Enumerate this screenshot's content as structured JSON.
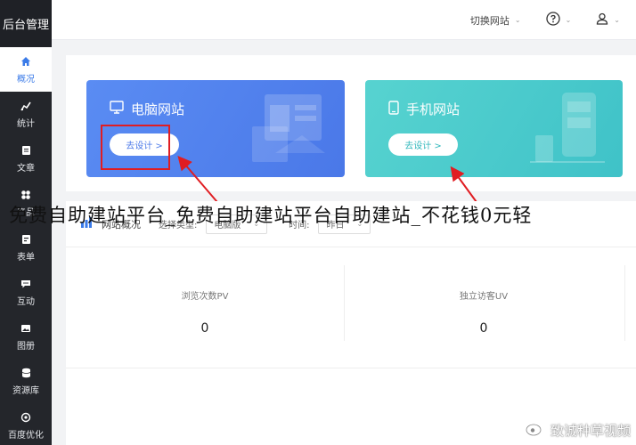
{
  "sidebar": {
    "logo": "后台管理",
    "items": [
      {
        "label": "概况",
        "icon": "home-icon"
      },
      {
        "label": "统计",
        "icon": "stats-icon"
      },
      {
        "label": "文章",
        "icon": "article-icon"
      },
      {
        "label": "产品",
        "icon": "product-icon"
      },
      {
        "label": "表单",
        "icon": "form-icon"
      },
      {
        "label": "互动",
        "icon": "chat-icon"
      },
      {
        "label": "图册",
        "icon": "gallery-icon"
      },
      {
        "label": "资源库",
        "icon": "database-icon"
      },
      {
        "label": "百度优化",
        "icon": "seo-icon"
      }
    ]
  },
  "header": {
    "switch_site": "切换网站"
  },
  "cards": {
    "pc": {
      "title": "电脑网站",
      "button": "去设计 >"
    },
    "mobile": {
      "title": "手机网站",
      "button": "去设计 >"
    }
  },
  "stats": {
    "title": "网站概况",
    "type_label": "选择类型:",
    "type_value": "电脑版",
    "time_label": "时间:",
    "time_value": "昨日",
    "metrics": [
      {
        "label": "浏览次数PV",
        "value": "0"
      },
      {
        "label": "独立访客UV",
        "value": "0"
      }
    ]
  },
  "overlay": {
    "text": "免费自助建站平台_免费自助建站平台自助建站_不花钱0元轻"
  },
  "watermark": {
    "text": "致诚种草视频"
  },
  "colors": {
    "accent": "#3b7be8",
    "pc_card": "#5a8cf3",
    "mobile_card": "#46c8cc",
    "annotation": "#e01d22"
  }
}
